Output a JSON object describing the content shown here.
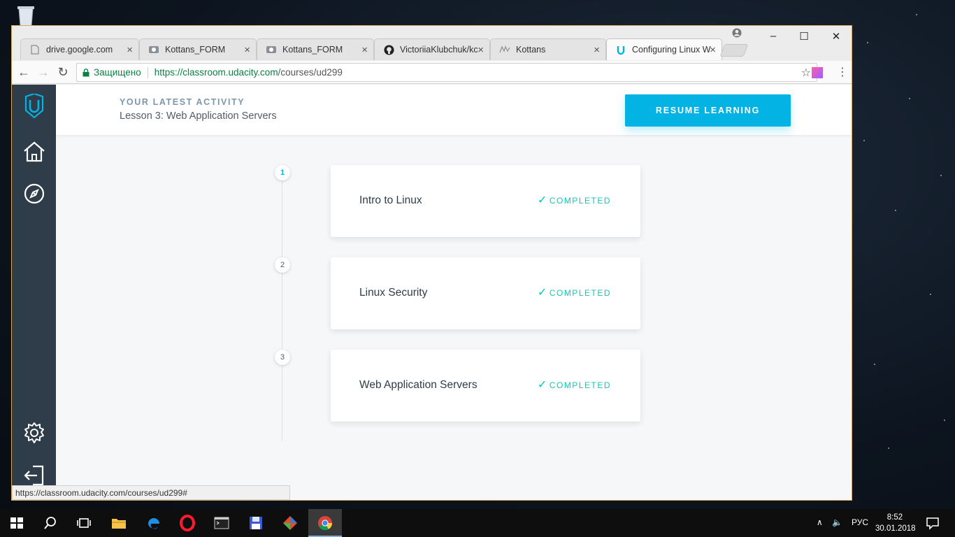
{
  "browser": {
    "tabs": [
      {
        "label": "drive.google.com",
        "icon": "page-icon"
      },
      {
        "label": "Kottans_FORM",
        "icon": "form-icon"
      },
      {
        "label": "Kottans_FORM",
        "icon": "form-icon"
      },
      {
        "label": "VictoriiaKlubchuk/kc",
        "icon": "github-icon"
      },
      {
        "label": "Kottans",
        "icon": "kottans-icon"
      },
      {
        "label": "Configuring Linux W",
        "icon": "udacity-icon",
        "active": true
      }
    ],
    "secure_label": "Защищено",
    "url_host": "https://classroom.udacity.com",
    "url_path": "/courses/ud299",
    "status_url": "https://classroom.udacity.com/courses/ud299#"
  },
  "page": {
    "latest_activity_label": "YOUR LATEST ACTIVITY",
    "latest_lesson": "Lesson 3: Web Application Servers",
    "resume_button": "RESUME LEARNING",
    "accent_color": "#02b3e4",
    "lessons": [
      {
        "number": "1",
        "title": "Intro to Linux",
        "status": "COMPLETED"
      },
      {
        "number": "2",
        "title": "Linux Security",
        "status": "COMPLETED"
      },
      {
        "number": "3",
        "title": "Web Application Servers",
        "status": "COMPLETED"
      }
    ]
  },
  "sidebar": {
    "items": [
      "udacity-logo-icon",
      "home-icon",
      "compass-icon",
      "gear-icon",
      "logout-icon"
    ]
  },
  "taskbar": {
    "language": "РУС",
    "time": "8:52",
    "date": "30.01.2018"
  }
}
